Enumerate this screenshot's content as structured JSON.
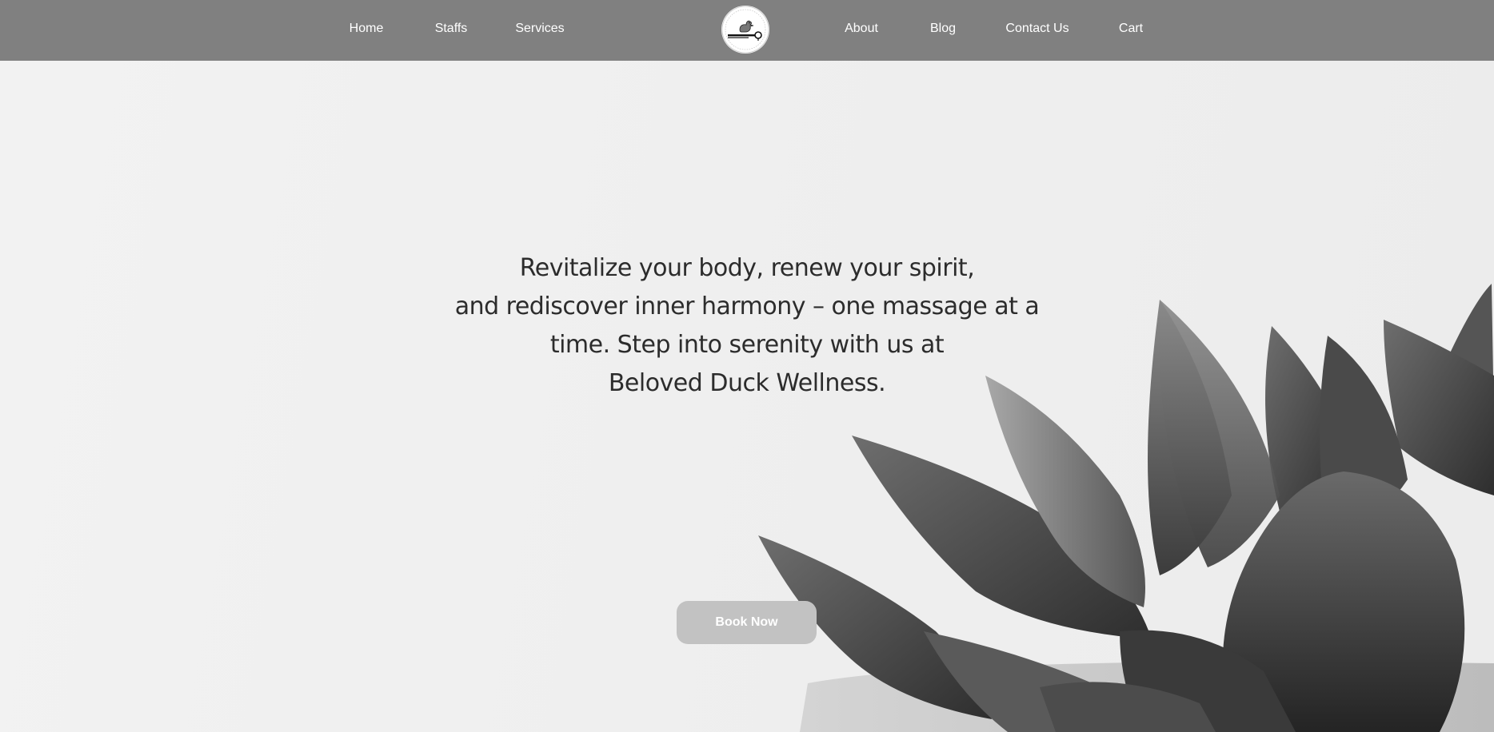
{
  "nav": {
    "left": [
      {
        "label": "Home"
      },
      {
        "label": "Staffs"
      },
      {
        "label": "Services"
      }
    ],
    "right": [
      {
        "label": "About"
      },
      {
        "label": "Blog"
      },
      {
        "label": "Contact Us"
      },
      {
        "label": "Cart"
      }
    ],
    "logo_icon": "duck-logo-icon"
  },
  "hero": {
    "lines": [
      "Revitalize your body, renew your spirit,",
      "and rediscover inner harmony – one massage at a",
      "time. Step into serenity with us at",
      "Beloved Duck Wellness."
    ],
    "button_label": "Book Now",
    "background_image": "succulent-plant-image"
  },
  "colors": {
    "header_bg": "#808080",
    "page_bg": "#f0f0f0",
    "text": "#2c2c2c",
    "button_bg": "#c2c2c2",
    "button_text": "#ffffff"
  }
}
